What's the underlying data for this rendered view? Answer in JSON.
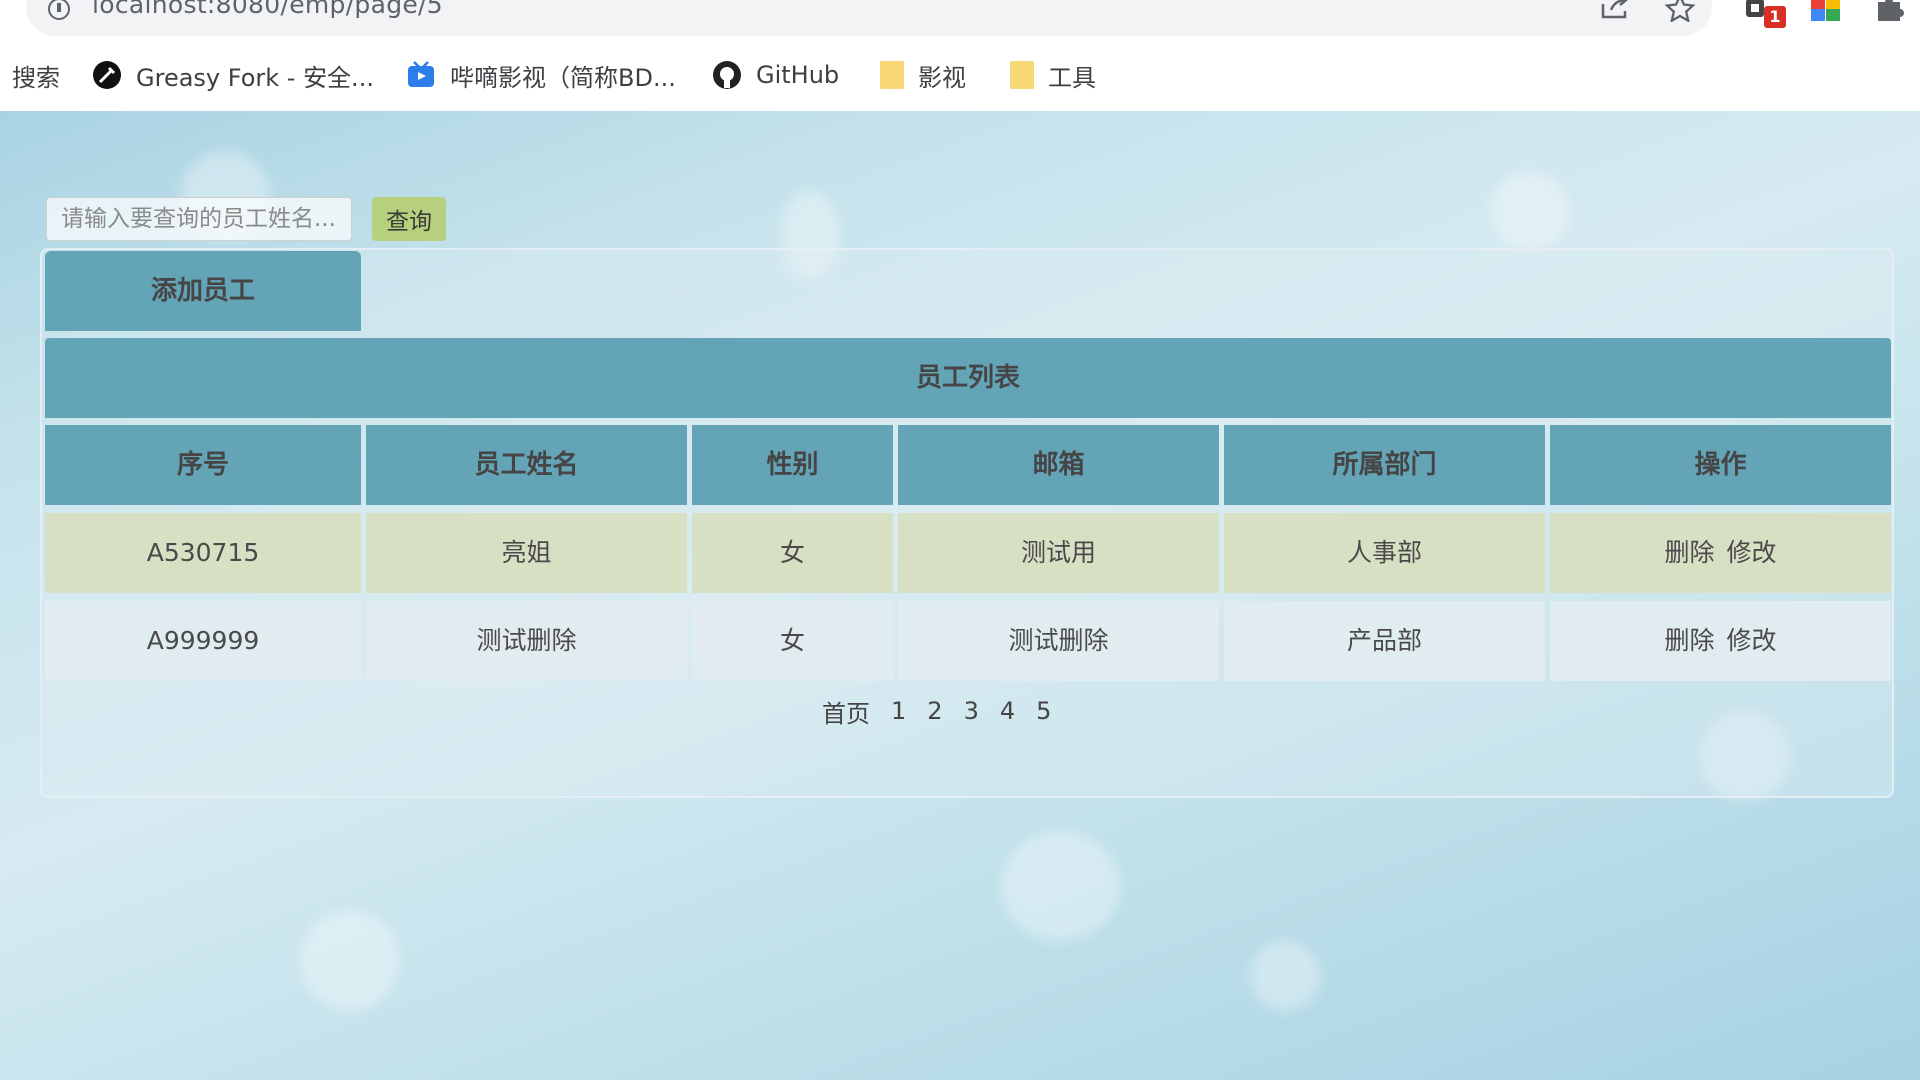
{
  "browser": {
    "url": "localhost:8080/emp/page/5",
    "extension_badge": "1",
    "bookmarks": [
      {
        "label": "搜索",
        "icon": "none"
      },
      {
        "label": "Greasy Fork - 安全...",
        "icon": "greasyfork-icon"
      },
      {
        "label": "哔嘀影视（简称BD...",
        "icon": "tv-icon"
      },
      {
        "label": "GitHub",
        "icon": "github-icon"
      },
      {
        "label": "影视",
        "icon": "folder-icon"
      },
      {
        "label": "工具",
        "icon": "folder-icon"
      }
    ]
  },
  "search": {
    "placeholder": "请输入要查询的员工姓名...",
    "button_label": "查询"
  },
  "add_button_label": "添加员工",
  "table": {
    "title": "员工列表",
    "columns": [
      "序号",
      "员工姓名",
      "性别",
      "邮箱",
      "所属部门",
      "操作"
    ],
    "rows": [
      {
        "id": "A530715",
        "name": "亮姐",
        "gender": "女",
        "email": "测试用",
        "department": "人事部",
        "delete_label": "删除",
        "edit_label": "修改"
      },
      {
        "id": "A999999",
        "name": "测试删除",
        "gender": "女",
        "email": "测试删除",
        "department": "产品部",
        "delete_label": "删除",
        "edit_label": "修改"
      }
    ]
  },
  "pagination": {
    "first_label": "首页",
    "pages": [
      "1",
      "2",
      "3",
      "4",
      "5"
    ]
  },
  "colors": {
    "header_bg": "#64a4b7",
    "highlight_row_bg": "#d8e0c4",
    "search_button_bg": "#b6d07e"
  }
}
